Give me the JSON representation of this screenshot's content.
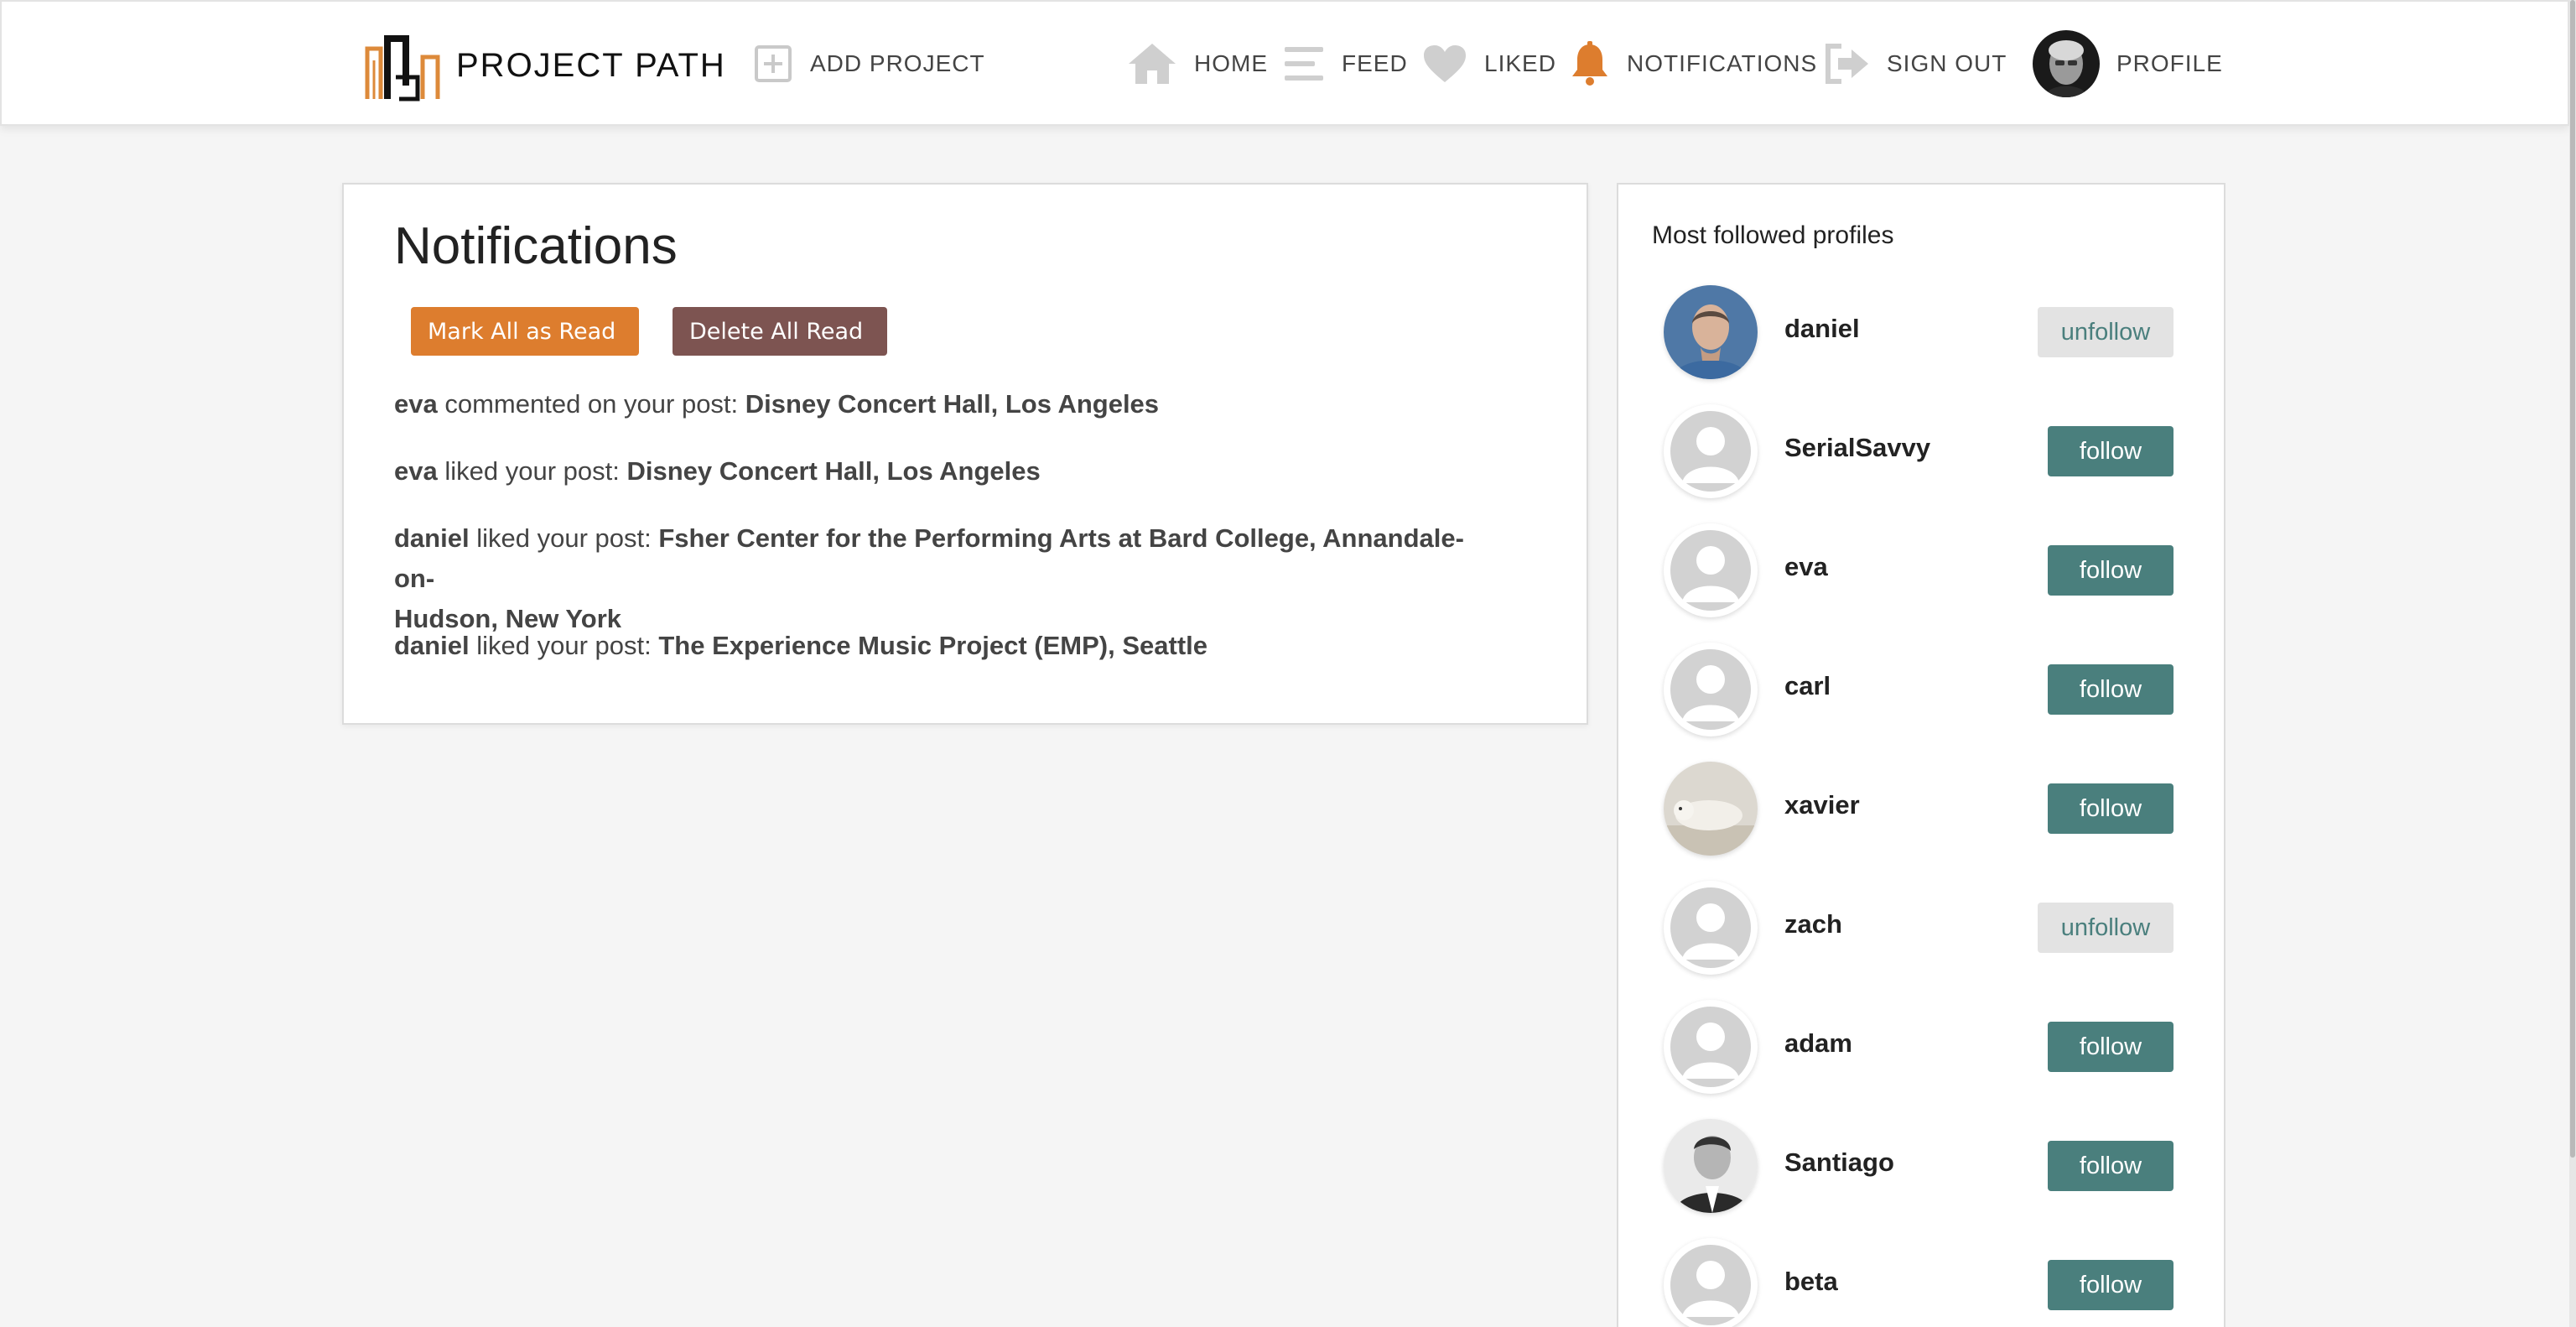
{
  "brand": {
    "name": "PROJECT PATH"
  },
  "nav": {
    "add_project": "ADD PROJECT",
    "home": "HOME",
    "feed": "FEED",
    "liked": "LIKED",
    "notifications": "NOTIFICATIONS",
    "sign_out": "SIGN OUT",
    "profile": "PROFILE"
  },
  "colors": {
    "accent_orange": "#dd7d2e",
    "delete_brown": "#7d5451",
    "follow_teal": "#4a7f7d",
    "unfollow_gray": "#e3e3e3",
    "nav_icon_gray": "#cfcfcf"
  },
  "notifications": {
    "title": "Notifications",
    "mark_all_label": "Mark All as Read",
    "delete_all_label": "Delete All Read",
    "items": [
      {
        "user": "eva",
        "action": "commented on your post:",
        "post": "Disney Concert Hall, Los Angeles"
      },
      {
        "user": "eva",
        "action": "liked your post:",
        "post": "Disney Concert Hall, Los Angeles"
      },
      {
        "user": "daniel",
        "action": "liked your post:",
        "post": "Fsher Center for the Performing Arts at Bard College, Annandale-on-",
        "post_cont": "Hudson, New York"
      },
      {
        "user": "daniel",
        "action": "liked your post:",
        "post": "The Experience Music Project (EMP), Seattle"
      }
    ]
  },
  "sidebar": {
    "title": "Most followed profiles",
    "profiles": [
      {
        "name": "daniel",
        "button": "unfollow",
        "avatar": "photo-man"
      },
      {
        "name": "SerialSavvy",
        "button": "follow",
        "avatar": "default"
      },
      {
        "name": "eva",
        "button": "follow",
        "avatar": "default"
      },
      {
        "name": "carl",
        "button": "follow",
        "avatar": "default"
      },
      {
        "name": "xavier",
        "button": "follow",
        "avatar": "photo-seal"
      },
      {
        "name": "zach",
        "button": "unfollow",
        "avatar": "default"
      },
      {
        "name": "adam",
        "button": "follow",
        "avatar": "default"
      },
      {
        "name": "Santiago",
        "button": "follow",
        "avatar": "photo-bw"
      },
      {
        "name": "beta",
        "button": "follow",
        "avatar": "default"
      }
    ]
  }
}
